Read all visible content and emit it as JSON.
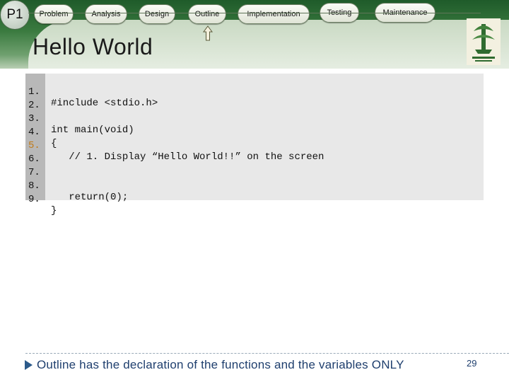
{
  "badge": "P1",
  "stages": [
    "Problem",
    "Analysis",
    "Design",
    "Outline",
    "Implementation",
    "Testing",
    "Maintenance"
  ],
  "title": "Hello World",
  "code": {
    "line_numbers": [
      "1.",
      "2.",
      "3.",
      "4.",
      "5.",
      "6.",
      "7.",
      "8.",
      "9."
    ],
    "highlighted_line": "5.",
    "lines": [
      "#include <stdio.h>",
      "",
      "int main(void)",
      "{",
      "   // 1. Display “Hello World!!” on the screen",
      "",
      "",
      "   return(0);",
      "}"
    ]
  },
  "footer": {
    "note": "Outline has the declaration of the functions and the variables ONLY",
    "page_number": "29"
  },
  "colors": {
    "header_green": "#1f5b2a",
    "stage_fill": "#fbfcf7",
    "code_bg": "#e8e8e8",
    "gutter_bg": "#b8b8b8",
    "footer_text": "#1f3f6e",
    "highlight_line_number": "#c07a18"
  },
  "icons": {
    "pointer": "up-arrow-icon",
    "logo": "university-logo-icon"
  }
}
